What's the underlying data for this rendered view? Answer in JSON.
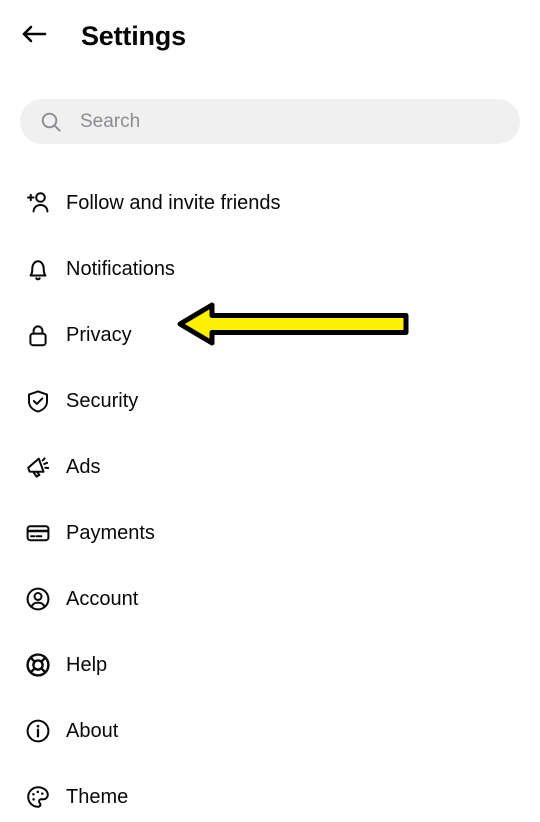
{
  "header": {
    "back_icon": "arrow-left-icon",
    "title": "Settings"
  },
  "search": {
    "icon": "search-icon",
    "placeholder": "Search",
    "value": ""
  },
  "settings_list": {
    "items": [
      {
        "label": "Follow and invite friends",
        "icon": "add-person-icon"
      },
      {
        "label": "Notifications",
        "icon": "bell-icon"
      },
      {
        "label": "Privacy",
        "icon": "lock-icon"
      },
      {
        "label": "Security",
        "icon": "shield-check-icon"
      },
      {
        "label": "Ads",
        "icon": "megaphone-icon"
      },
      {
        "label": "Payments",
        "icon": "credit-card-icon"
      },
      {
        "label": "Account",
        "icon": "user-circle-icon"
      },
      {
        "label": "Help",
        "icon": "lifebuoy-icon"
      },
      {
        "label": "About",
        "icon": "info-circle-icon"
      },
      {
        "label": "Theme",
        "icon": "palette-icon"
      }
    ]
  },
  "annotation": {
    "type": "arrow-left",
    "points_to": "Privacy",
    "fill_color": "#FFF200",
    "outline_color": "#000000"
  },
  "colors": {
    "background": "#FFFFFF",
    "text": "#080809",
    "search_background": "#F0F0F0",
    "placeholder": "#8A8D91"
  }
}
